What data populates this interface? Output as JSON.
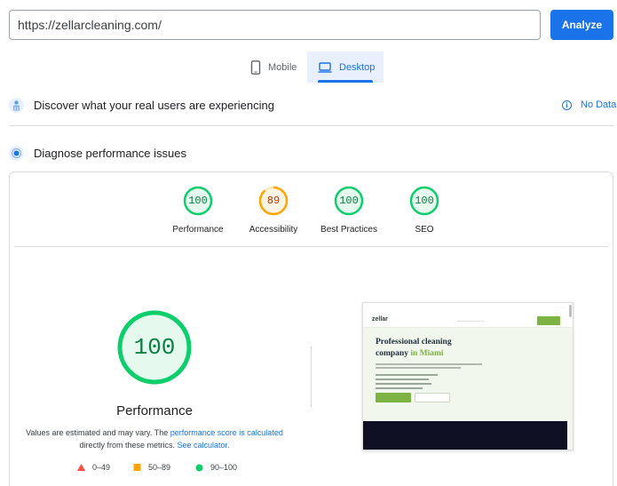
{
  "search": {
    "url_value": "https://zellarcleaning.com/",
    "analyze_label": "Analyze"
  },
  "tabs": [
    {
      "label": "Mobile",
      "icon": "smartphone-icon",
      "selected": false
    },
    {
      "label": "Desktop",
      "icon": "laptop-icon",
      "selected": true
    }
  ],
  "real_users": {
    "title": "Discover what your real users are experiencing",
    "status": "No Data",
    "icon": "users-icon"
  },
  "diagnose": {
    "title": "Diagnose performance issues",
    "icon": "lab-icon"
  },
  "scores": [
    {
      "value": "100",
      "label": "Performance",
      "score": 100,
      "color": "#0cce6b",
      "text_color": "#0b8043"
    },
    {
      "value": "89",
      "label": "Accessibility",
      "score": 89,
      "color": "#ffa400",
      "text_color": "#c33300"
    },
    {
      "value": "100",
      "label": "Best Practices",
      "score": 100,
      "color": "#0cce6b",
      "text_color": "#0b8043"
    },
    {
      "value": "100",
      "label": "SEO",
      "score": 100,
      "color": "#0cce6b",
      "text_color": "#0b8043"
    }
  ],
  "performance": {
    "score": "100",
    "title": "Performance",
    "note_prefix": "Values are estimated and may vary. The",
    "note_link1": "performance score is calculated",
    "note_middle": "directly from these metrics.",
    "note_link2": "See calculator."
  },
  "legend": [
    {
      "range": "0–49",
      "color": "#ff4e42",
      "shape": "triangle"
    },
    {
      "range": "50–89",
      "color": "#ffa400",
      "shape": "square"
    },
    {
      "range": "90–100",
      "color": "#0cce6b",
      "shape": "circle"
    }
  ],
  "screenshot": {
    "logo": "zellar",
    "hero_line1": "Professional cleaning",
    "hero_line2": "company",
    "hero_highlight": "in Miami"
  }
}
